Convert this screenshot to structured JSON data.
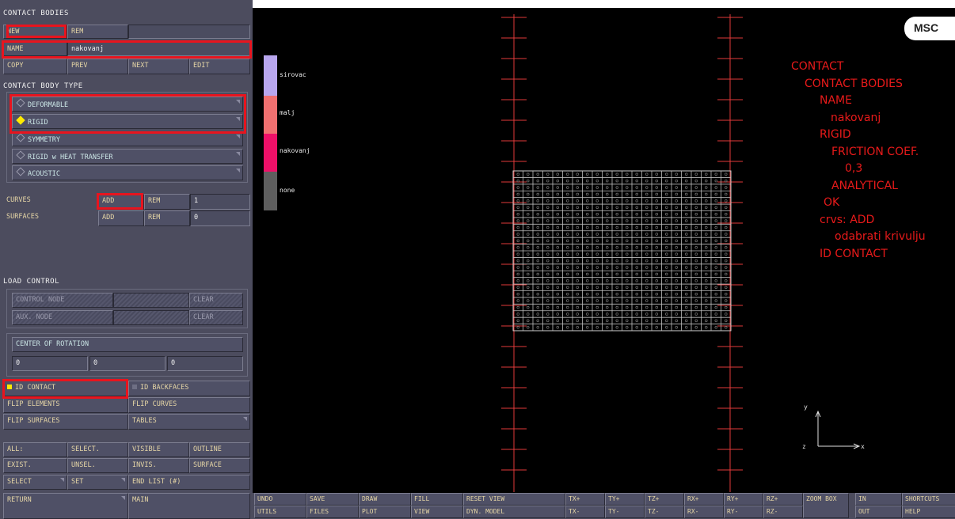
{
  "panel": {
    "contact_bodies_title": "CONTACT BODIES",
    "new_label": "NEW",
    "rem_label": "REM",
    "name_label": "NAME",
    "name_value": "nakovanj",
    "copy_label": "COPY",
    "prev_label": "PREV",
    "next_label": "NEXT",
    "edit_label": "EDIT",
    "body_type_title": "CONTACT BODY TYPE",
    "body_types": [
      {
        "label": "DEFORMABLE",
        "selected": false
      },
      {
        "label": "RIGID",
        "selected": true
      },
      {
        "label": "SYMMETRY",
        "selected": false
      },
      {
        "label": "RIGID w HEAT TRANSFER",
        "selected": false
      },
      {
        "label": "ACOUSTIC",
        "selected": false
      }
    ],
    "curves_label": "CURVES",
    "curves_add": "ADD",
    "curves_rem": "REM",
    "curves_count": "1",
    "surfaces_label": "SURFACES",
    "surfaces_add": "ADD",
    "surfaces_rem": "REM",
    "surfaces_count": "0",
    "load_control_title": "LOAD CONTROL",
    "control_node_label": "CONTROL NODE",
    "clear1_label": "CLEAR",
    "aux_node_label": "AUX. NODE",
    "clear2_label": "CLEAR",
    "center_rotation_label": "CENTER OF ROTATION",
    "rot_x": "0",
    "rot_y": "0",
    "rot_z": "0",
    "id_contact_label": "ID CONTACT",
    "id_backfaces_label": "ID BACKFACES",
    "flip_elements_label": "FLIP ELEMENTS",
    "flip_curves_label": "FLIP CURVES",
    "flip_surfaces_label": "FLIP SURFACES",
    "tables_label": "TABLES",
    "all_label": "ALL:",
    "select_dot_label": "SELECT.",
    "visible_label": "VISIBLE",
    "outline_label": "OUTLINE",
    "exist_label": "EXIST.",
    "unsel_label": "UNSEL.",
    "invis_label": "INVIS.",
    "surface_label": "SURFACE",
    "select_label": "SELECT",
    "set_label": "SET",
    "end_list_label": "END LIST (#)",
    "return_label": "RETURN",
    "main_label": "MAIN"
  },
  "legend": [
    {
      "label": "sirovac",
      "color": "#b8a6ee"
    },
    {
      "label": "malj",
      "color": "#f07070"
    },
    {
      "label": "nakovanj",
      "color": "#ee1068"
    },
    {
      "label": "none",
      "color": "#5e5e5e"
    }
  ],
  "logo_text": "MSC",
  "axis": {
    "x": "x",
    "y": "y",
    "z": "z"
  },
  "instructions": [
    "CONTACT",
    "CONTACT BODIES",
    "NAME",
    "nakovanj",
    "RIGID",
    "FRICTION COEF.",
    "0,3",
    "ANALYTICAL",
    "OK",
    "crvs: ADD",
    "odabrati krivulju",
    "ID CONTACT"
  ],
  "toolbar": {
    "row1": [
      "UNDO",
      "SAVE",
      "DRAW",
      "FILL",
      "RESET VIEW",
      "TX+",
      "TY+",
      "TZ+",
      "RX+",
      "RY+",
      "RZ+",
      "ZOOM BOX",
      "IN",
      "SHORTCUTS"
    ],
    "row2": [
      "UTILS",
      "FILES",
      "PLOT",
      "VIEW",
      "DYN. MODEL",
      "TX-",
      "TY-",
      "TZ-",
      "RX-",
      "RY-",
      "RZ-",
      "OUT",
      "HELP"
    ]
  },
  "colors": {
    "highlight": "#e8141e",
    "panel": "#4c4c5e",
    "viewport": "#000000",
    "annotation": "#e81a1a"
  }
}
